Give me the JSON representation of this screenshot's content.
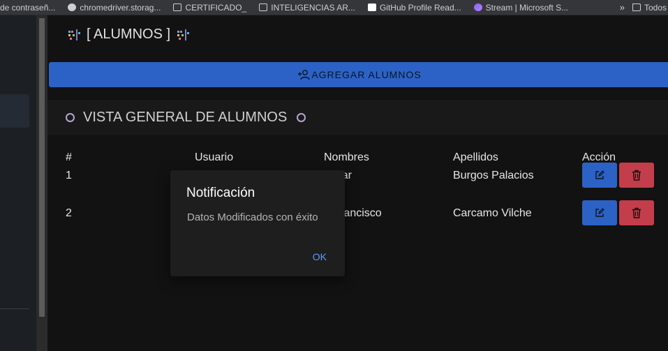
{
  "bookmarks": {
    "items": [
      {
        "label": "de contraseñ...",
        "icon": "none"
      },
      {
        "label": "chromedriver.storag...",
        "icon": "globe-icon"
      },
      {
        "label": "CERTIFICADO_",
        "icon": "folder-icon"
      },
      {
        "label": "INTELIGENCIAS AR...",
        "icon": "folder-icon"
      },
      {
        "label": "GitHub Profile Read...",
        "icon": "github-icon"
      },
      {
        "label": "Stream | Microsoft S...",
        "icon": "stream-icon"
      }
    ],
    "more_label": "»",
    "all_label": "Todos"
  },
  "page": {
    "title": "[ ALUMNOS ]",
    "add_button_label": "AGREGAR ALUMNOS",
    "section_title": "VISTA GENERAL DE ALUMNOS"
  },
  "table": {
    "headers": [
      "#",
      "Usuario",
      "Nombres",
      "Apellidos",
      "Acción"
    ],
    "rows": [
      {
        "num": "1",
        "user": "",
        "names": "Omar",
        "surnames": "Burgos Palacios"
      },
      {
        "num": "2",
        "user": "",
        "names": "n Francisco",
        "surnames": "Carcamo Vilche"
      }
    ]
  },
  "dialog": {
    "title": "Notificación",
    "message": "Datos Modificados con éxito",
    "ok_label": "OK"
  },
  "colors": {
    "primary": "#2c62c5",
    "danger": "#c43d4a",
    "background": "#121212",
    "accent_link": "#5e9cff"
  }
}
